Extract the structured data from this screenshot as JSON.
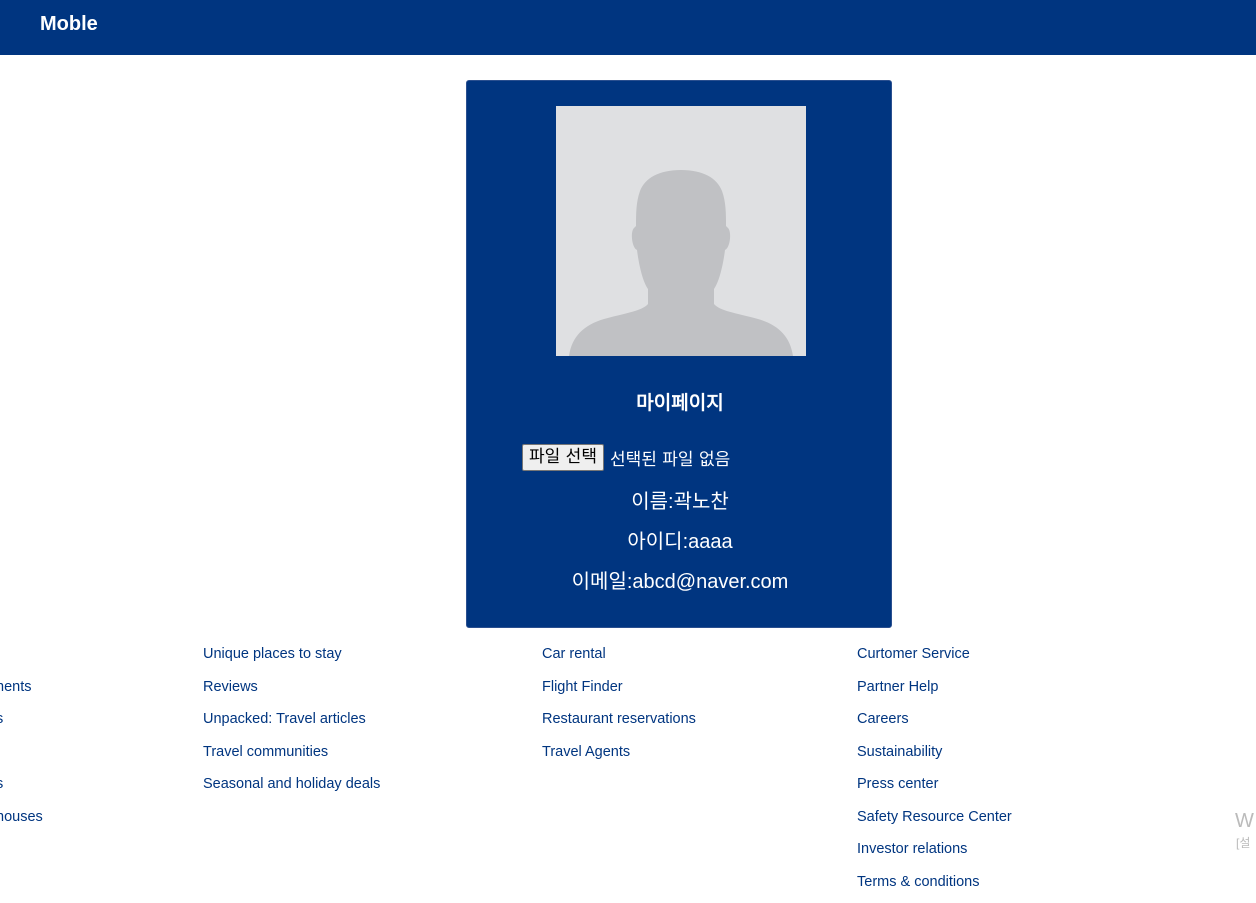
{
  "header": {
    "brand": "Moble",
    "background": "#003580"
  },
  "profile_card": {
    "avatar_alt": "default profile silhouette",
    "title": "마이페이지",
    "file_input": {
      "button_label": "파일 선택",
      "status": "선택된 파일 없음"
    },
    "name_line": "이름:곽노찬",
    "id_line": "아이디:aaaa",
    "email_line": "이메일:abcd@naver.com"
  },
  "footer": {
    "col1": [
      "",
      "nents",
      "s",
      "",
      "s",
      "nouses"
    ],
    "col2": [
      "Unique places to stay",
      "Reviews",
      "Unpacked: Travel articles",
      "Travel communities",
      "Seasonal and holiday deals"
    ],
    "col3": [
      "Car rental",
      "Flight Finder",
      "Restaurant reservations",
      "Travel Agents"
    ],
    "col4": [
      "Curtomer Service",
      "Partner Help",
      "Careers",
      "Sustainability",
      "Press center",
      "Safety Resource Center",
      "Investor relations",
      "Terms & conditions"
    ]
  },
  "watermark": {
    "main": "W",
    "sub": "[설"
  },
  "colors": {
    "accent": "#003580",
    "footer_link": "#003580",
    "avatar_bg": "#dfe0e2",
    "silhouette": "#c0c1c4"
  }
}
